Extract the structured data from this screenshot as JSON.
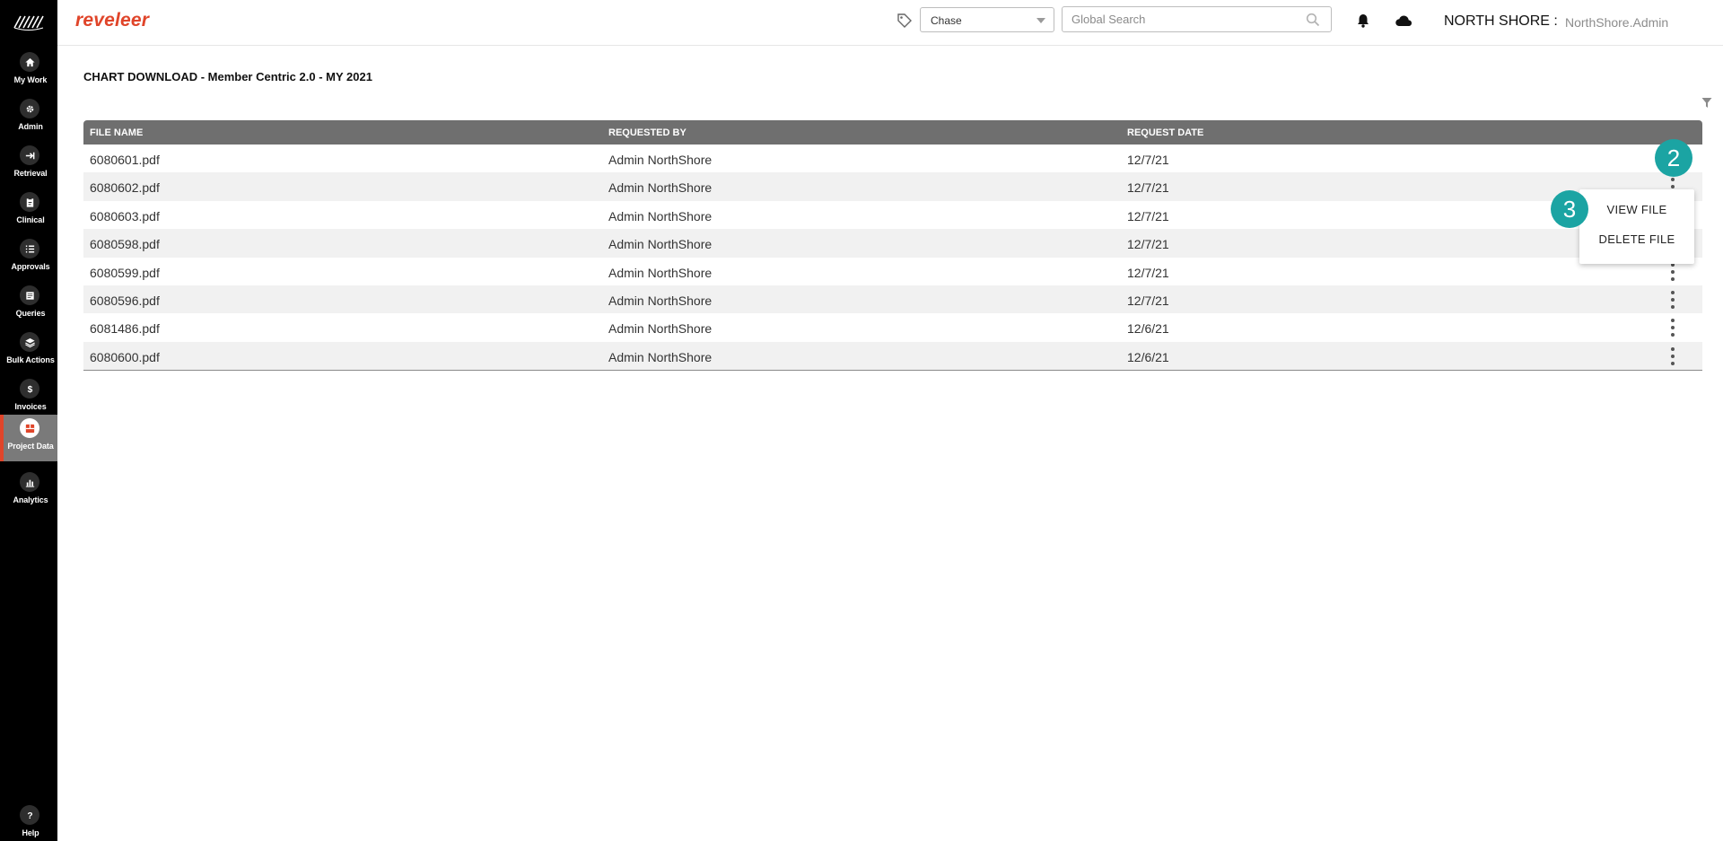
{
  "sidebar": {
    "items": [
      {
        "label": "My Work",
        "icon": "home-icon"
      },
      {
        "label": "Admin",
        "icon": "admin-gear-icon"
      },
      {
        "label": "Retrieval",
        "icon": "arrow-in-icon"
      },
      {
        "label": "Clinical",
        "icon": "clipboard-icon"
      },
      {
        "label": "Approvals",
        "icon": "checklist-icon"
      },
      {
        "label": "Queries",
        "icon": "document-icon"
      },
      {
        "label": "Bulk Actions",
        "icon": "layers-icon"
      },
      {
        "label": "Invoices",
        "icon": "dollar-icon"
      },
      {
        "label": "Project Data",
        "icon": "project-data-icon",
        "active": true
      },
      {
        "label": "Analytics",
        "icon": "bar-chart-icon"
      }
    ],
    "help_label": "Help"
  },
  "header": {
    "brand": "reveleer",
    "chase_select_value": "Chase",
    "search_placeholder": "Global Search",
    "org_name": "NORTH SHORE :",
    "org_user": "NorthShore.Admin"
  },
  "page": {
    "title": "CHART DOWNLOAD - Member Centric 2.0 - MY 2021"
  },
  "table": {
    "columns": [
      "FILE NAME",
      "REQUESTED BY",
      "REQUEST DATE"
    ],
    "rows": [
      {
        "file": "6080601.pdf",
        "by": "Admin NorthShore",
        "date": "12/7/21"
      },
      {
        "file": "6080602.pdf",
        "by": "Admin NorthShore",
        "date": "12/7/21"
      },
      {
        "file": "6080603.pdf",
        "by": "Admin NorthShore",
        "date": "12/7/21"
      },
      {
        "file": "6080598.pdf",
        "by": "Admin NorthShore",
        "date": "12/7/21"
      },
      {
        "file": "6080599.pdf",
        "by": "Admin NorthShore",
        "date": "12/7/21"
      },
      {
        "file": "6080596.pdf",
        "by": "Admin NorthShore",
        "date": "12/7/21"
      },
      {
        "file": "6081486.pdf",
        "by": "Admin NorthShore",
        "date": "12/6/21"
      },
      {
        "file": "6080600.pdf",
        "by": "Admin NorthShore",
        "date": "12/6/21"
      }
    ]
  },
  "menu": {
    "view_file": "VIEW FILE",
    "delete_file": "DELETE FILE"
  },
  "badges": {
    "step_two": "2",
    "step_three": "3"
  },
  "colors": {
    "brand": "#e0452a",
    "sidebar": "#000000",
    "table_header": "#6f6f6f",
    "badge": "#1ba4a3"
  }
}
